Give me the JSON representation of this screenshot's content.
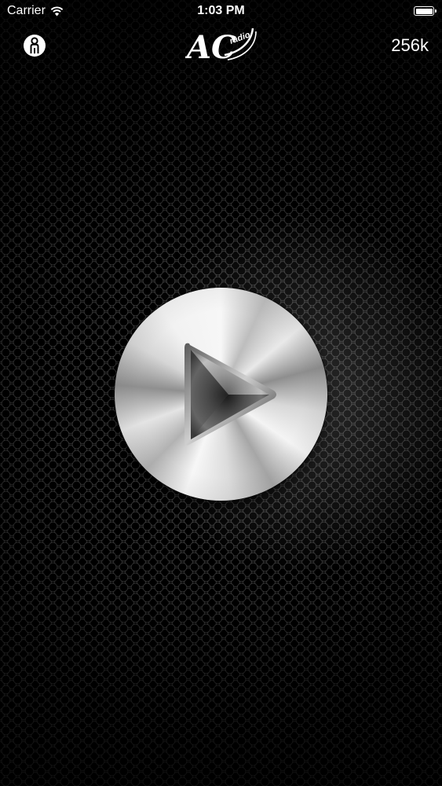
{
  "status_bar": {
    "carrier": "Carrier",
    "time": "1:03 PM",
    "wifi_icon": "wifi-icon",
    "battery_icon": "battery-icon"
  },
  "nav": {
    "user_icon": "user-icon",
    "logo_text_main": "AC",
    "logo_text_sub": "radio",
    "bitrate": "256k"
  },
  "player": {
    "play_icon": "play-icon"
  },
  "colors": {
    "text": "#ffffff",
    "background": "#050505"
  }
}
